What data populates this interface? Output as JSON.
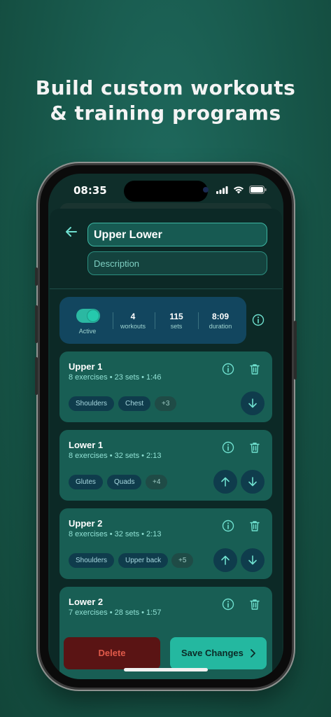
{
  "headline": {
    "line1": "Build custom workouts",
    "line2": "& training programs"
  },
  "status_bar": {
    "time": "08:35"
  },
  "program": {
    "name": "Upper Lower",
    "description_placeholder": "Description"
  },
  "stats": {
    "active_label": "Active",
    "active": true,
    "workouts_value": "4",
    "workouts_label": "workouts",
    "sets_value": "115",
    "sets_label": "sets",
    "duration_value": "8:09",
    "duration_label": "duration"
  },
  "workouts": [
    {
      "title": "Upper 1",
      "meta": "8 exercises • 23 sets • 1:46",
      "tags": [
        "Shoulders",
        "Chest"
      ],
      "more": "+3"
    },
    {
      "title": "Lower 1",
      "meta": "8 exercises • 32 sets • 2:13",
      "tags": [
        "Glutes",
        "Quads"
      ],
      "more": "+4"
    },
    {
      "title": "Upper 2",
      "meta": "8 exercises • 32 sets • 2:13",
      "tags": [
        "Shoulders",
        "Upper back"
      ],
      "more": "+5"
    },
    {
      "title": "Lower 2",
      "meta": "7 exercises • 28 sets • 1:57",
      "tags": [],
      "more": ""
    }
  ],
  "actions": {
    "delete_label": "Delete",
    "save_label": "Save Changes"
  },
  "colors": {
    "accent": "#24b8a0",
    "danger": "#e05a4a",
    "background": "#175649"
  },
  "icons": [
    "back-arrow-icon",
    "info-icon",
    "trash-icon",
    "arrow-up-icon",
    "arrow-down-icon",
    "chevron-right-icon",
    "signal-icon",
    "wifi-icon",
    "battery-icon"
  ]
}
